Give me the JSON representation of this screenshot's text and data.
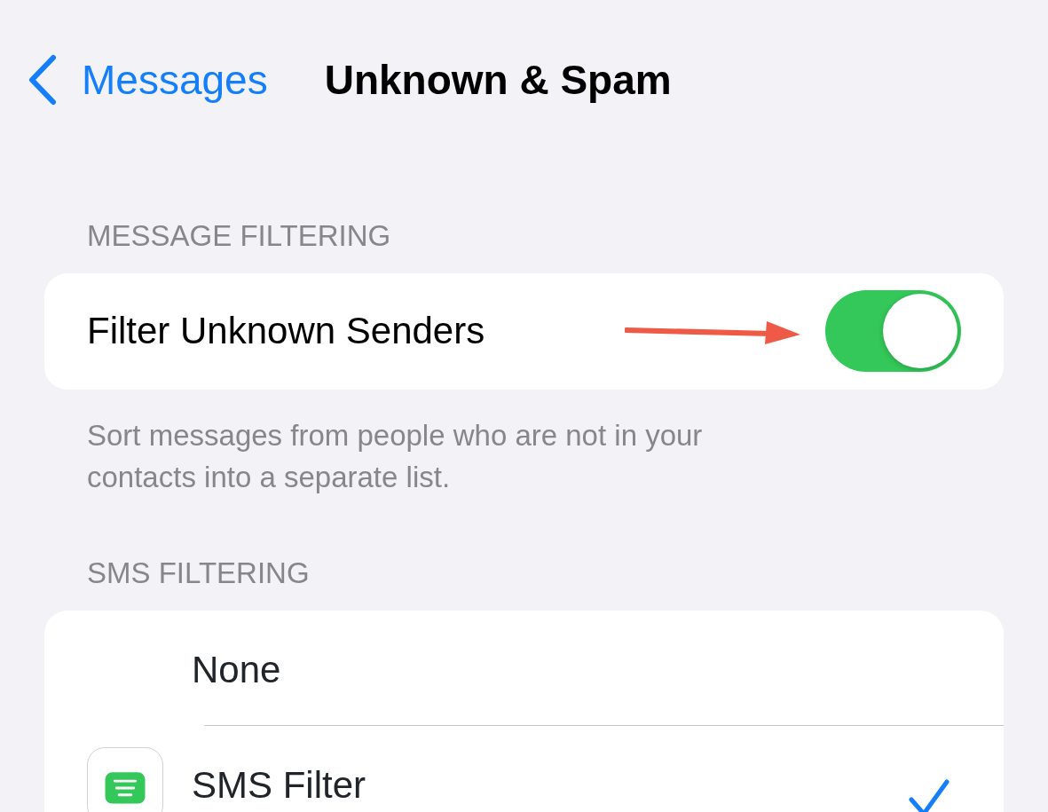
{
  "nav": {
    "back_label": "Messages",
    "title": "Unknown & Spam"
  },
  "sections": [
    {
      "header": "MESSAGE FILTERING",
      "rows": [
        {
          "kind": "toggle",
          "label": "Filter Unknown Senders",
          "on": true
        }
      ],
      "footer": "Sort messages from people who are not in your contacts into a separate list."
    },
    {
      "header": "SMS FILTERING",
      "rows": [
        {
          "kind": "plain",
          "label": "None",
          "selected": false
        },
        {
          "kind": "app",
          "label": "SMS Filter",
          "selected": true
        }
      ]
    }
  ]
}
